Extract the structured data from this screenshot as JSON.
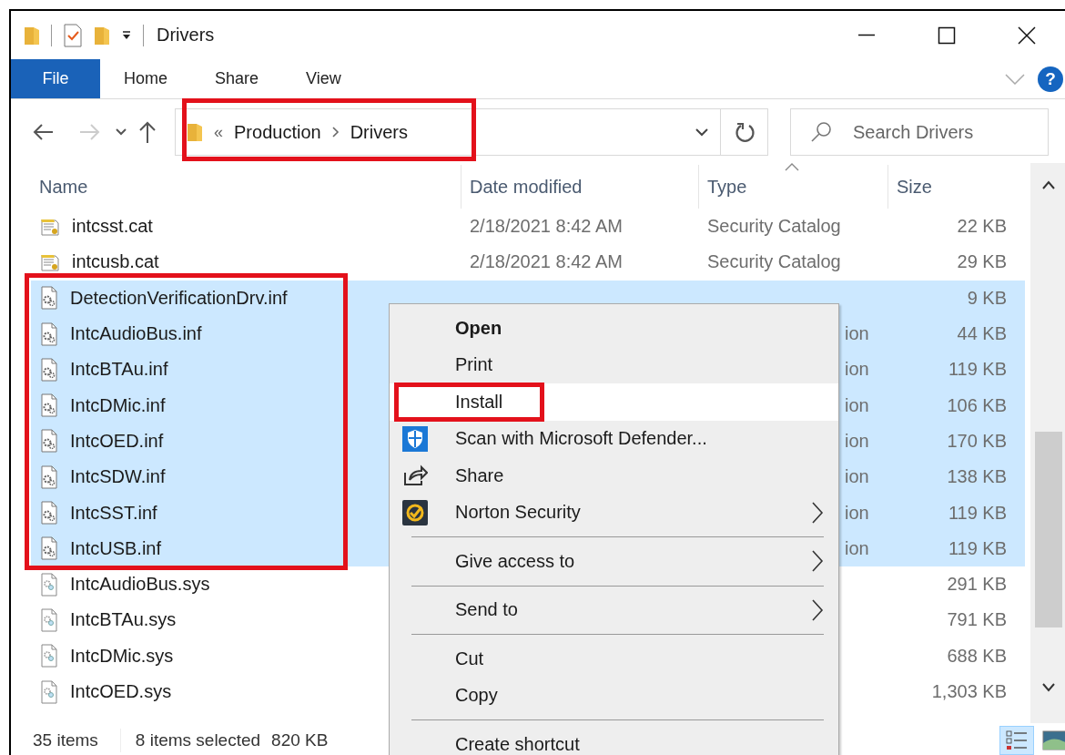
{
  "window": {
    "title": "Drivers"
  },
  "ribbon_tabs": [
    {
      "label": "File",
      "kind": "file"
    },
    {
      "label": "Home",
      "kind": "tab"
    },
    {
      "label": "Share",
      "kind": "tab"
    },
    {
      "label": "View",
      "kind": "tab"
    }
  ],
  "address": {
    "overflow": "«",
    "breadcrumbs": [
      "Production",
      "Drivers"
    ]
  },
  "search": {
    "placeholder": "Search Drivers"
  },
  "columns": [
    {
      "label": "Name",
      "sorted": false
    },
    {
      "label": "Date modified",
      "sorted": false
    },
    {
      "label": "Type",
      "sorted": true
    },
    {
      "label": "Size",
      "sorted": false
    }
  ],
  "files": [
    {
      "kind": "catalog",
      "name": "intcsst.cat",
      "date": "2/18/2021 8:42 AM",
      "type": "Security Catalog",
      "size": "22 KB",
      "selected": false
    },
    {
      "kind": "catalog",
      "name": "intcusb.cat",
      "date": "2/18/2021 8:42 AM",
      "type": "Security Catalog",
      "size": "29 KB",
      "selected": false
    },
    {
      "kind": "setup",
      "name": "DetectionVerificationDrv.inf",
      "size": "9 KB",
      "selected": true
    },
    {
      "kind": "setup",
      "name": "IntcAudioBus.inf",
      "type": "ion",
      "size": "44 KB",
      "selected": true
    },
    {
      "kind": "setup",
      "name": "IntcBTAu.inf",
      "type": "ion",
      "size": "119 KB",
      "selected": true
    },
    {
      "kind": "setup",
      "name": "IntcDMic.inf",
      "type": "ion",
      "size": "106 KB",
      "selected": true
    },
    {
      "kind": "setup",
      "name": "IntcOED.inf",
      "type": "ion",
      "size": "170 KB",
      "selected": true
    },
    {
      "kind": "setup",
      "name": "IntcSDW.inf",
      "type": "ion",
      "size": "138 KB",
      "selected": true
    },
    {
      "kind": "setup",
      "name": "IntcSST.inf",
      "type": "ion",
      "size": "119 KB",
      "selected": true
    },
    {
      "kind": "setup",
      "name": "IntcUSB.inf",
      "type": "ion",
      "size": "119 KB",
      "selected": true
    },
    {
      "kind": "system",
      "name": "IntcAudioBus.sys",
      "size": "291 KB",
      "selected": false
    },
    {
      "kind": "system",
      "name": "IntcBTAu.sys",
      "size": "791 KB",
      "selected": false
    },
    {
      "kind": "system",
      "name": "IntcDMic.sys",
      "size": "688 KB",
      "selected": false
    },
    {
      "kind": "system",
      "name": "IntcOED.sys",
      "size": "1,303 KB",
      "selected": false
    }
  ],
  "context_menu": [
    {
      "kind": "item",
      "label": "Open",
      "bold": true,
      "selected": false,
      "submenu": false
    },
    {
      "kind": "item",
      "label": "Print",
      "bold": false,
      "selected": false,
      "submenu": false
    },
    {
      "kind": "item",
      "label": "Install",
      "bold": false,
      "selected": true,
      "submenu": false
    },
    {
      "kind": "shield",
      "label": "Scan with Microsoft Defender...",
      "bold": false,
      "selected": false,
      "submenu": false
    },
    {
      "kind": "share",
      "label": "Share",
      "bold": false,
      "selected": false,
      "submenu": false
    },
    {
      "kind": "badge",
      "label": "Norton Security",
      "bold": false,
      "selected": false,
      "submenu": true
    },
    {
      "kind": "separator"
    },
    {
      "kind": "item",
      "label": "Give access to",
      "bold": false,
      "selected": false,
      "submenu": true
    },
    {
      "kind": "separator"
    },
    {
      "kind": "item",
      "label": "Send to",
      "bold": false,
      "selected": false,
      "submenu": true
    },
    {
      "kind": "separator"
    },
    {
      "kind": "item",
      "label": "Cut",
      "bold": false,
      "selected": false,
      "submenu": false
    },
    {
      "kind": "item",
      "label": "Copy",
      "bold": false,
      "selected": false,
      "submenu": false
    },
    {
      "kind": "separator"
    },
    {
      "kind": "item",
      "label": "Create shortcut",
      "bold": false,
      "selected": false,
      "submenu": false
    }
  ],
  "help_button": "?",
  "status_bar": {
    "count": "35 items",
    "selection": "8 items selected",
    "selection_size": "820 KB"
  },
  "view_buttons": [
    {
      "kind": "details",
      "selected": true
    },
    {
      "kind": "large-icons",
      "selected": false
    }
  ]
}
